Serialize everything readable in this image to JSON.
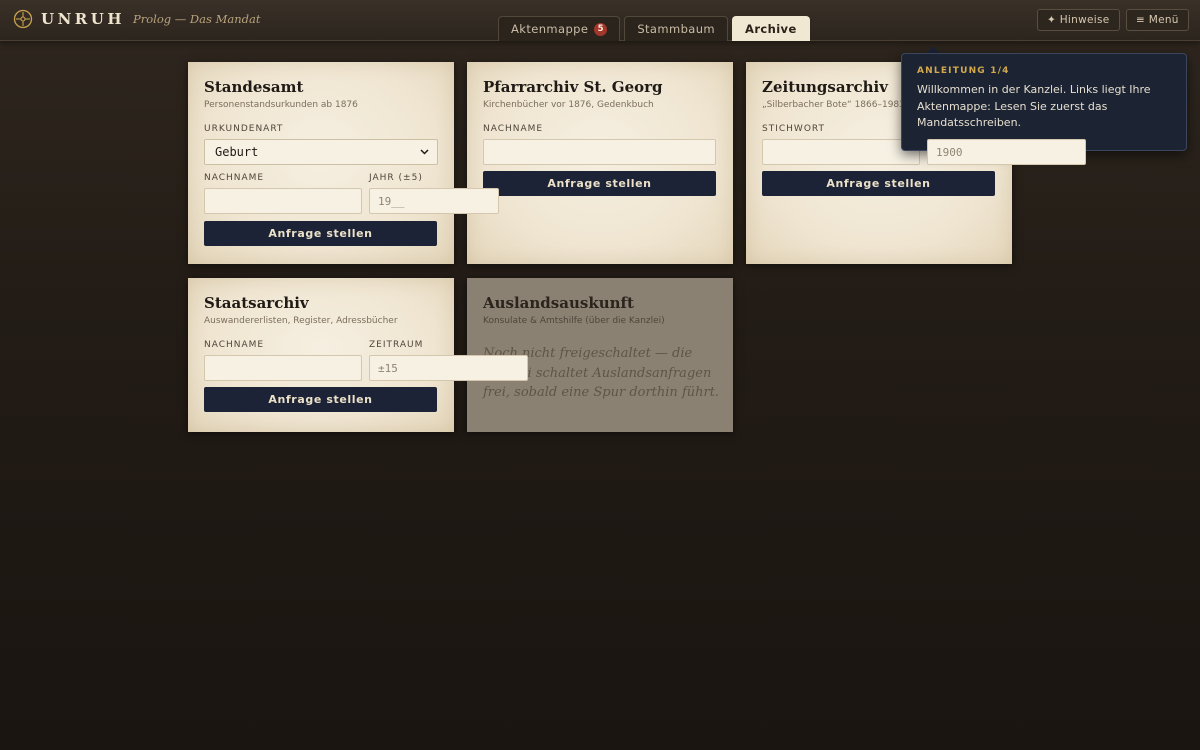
{
  "header": {
    "brand": "UNRUH",
    "subtitle": "Prolog — Das Mandat",
    "tabs": [
      {
        "label": "Aktenmappe",
        "badge": "5"
      },
      {
        "label": "Stammbaum"
      },
      {
        "label": "Archive",
        "active": true
      }
    ],
    "hints_label": "✦ Hinweise",
    "menu_label": "≡ Menü"
  },
  "cards": {
    "standesamt": {
      "title": "Standesamt",
      "subtitle": "Personenstandsurkunden ab 1876",
      "type_label": "URKUNDENART",
      "type_value": "Geburt",
      "name_label": "NACHNAME",
      "year_label": "JAHR (±5)",
      "year_placeholder": "19__",
      "button": "Anfrage stellen"
    },
    "pfarrarchiv": {
      "title": "Pfarrarchiv St. Georg",
      "subtitle": "Kirchenbücher vor 1876, Gedenkbuch",
      "name_label": "NACHNAME",
      "button": "Anfrage stellen"
    },
    "zeitung": {
      "title": "Zeitungsarchiv",
      "subtitle": "„Silberbacher Bote“ 1866–1983",
      "keyword_label": "STICHWORT",
      "year_placeholder": "1900",
      "button": "Anfrage stellen"
    },
    "staatsarchiv": {
      "title": "Staatsarchiv",
      "subtitle": "Auswandererlisten, Register, Adressbücher",
      "name_label": "NACHNAME",
      "range_label": "ZEITRAUM",
      "range_placeholder": "±15",
      "button": "Anfrage stellen"
    },
    "ausland": {
      "title": "Auslandsauskunft",
      "subtitle": "Konsulate & Amtshilfe (über die Kanzlei)",
      "locked_text": "Noch nicht freigeschaltet — die Kanzlei schaltet Auslandsanfragen frei, sobald eine Spur dorthin führt."
    }
  },
  "tooltip": {
    "step": "ANLEITUNG 1/4",
    "text": "Willkommen in der Kanzlei. Links liegt Ihre Aktenmappe: Lesen Sie zuerst das Mandatsschreiben."
  }
}
